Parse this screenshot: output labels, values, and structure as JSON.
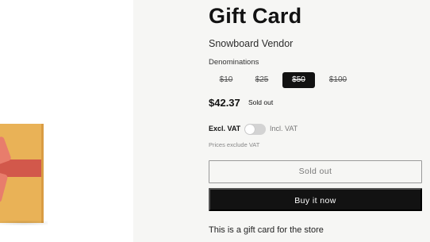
{
  "product": {
    "title": "Gift Card",
    "vendor": "Snowboard Vendor",
    "denominations_label": "Denominations",
    "denominations": [
      "$10",
      "$25",
      "$50",
      "$100"
    ],
    "selected_denomination": "$50",
    "price": "$42.37",
    "sold_out_badge": "Sold out",
    "description": "This is a gift card for the store"
  },
  "vat": {
    "excl_label": "Excl. VAT",
    "incl_label": "Incl. VAT",
    "toggle_on": false,
    "note": "Prices exclude VAT"
  },
  "buttons": {
    "sold_out": "Sold out",
    "buy_now": "Buy it now"
  },
  "colors": {
    "accent": "#121212",
    "background": "#f6f6f4",
    "card": "#e9b257",
    "ribbon": "#d2584b"
  },
  "icons": {
    "product_image": "gift-card-image"
  }
}
